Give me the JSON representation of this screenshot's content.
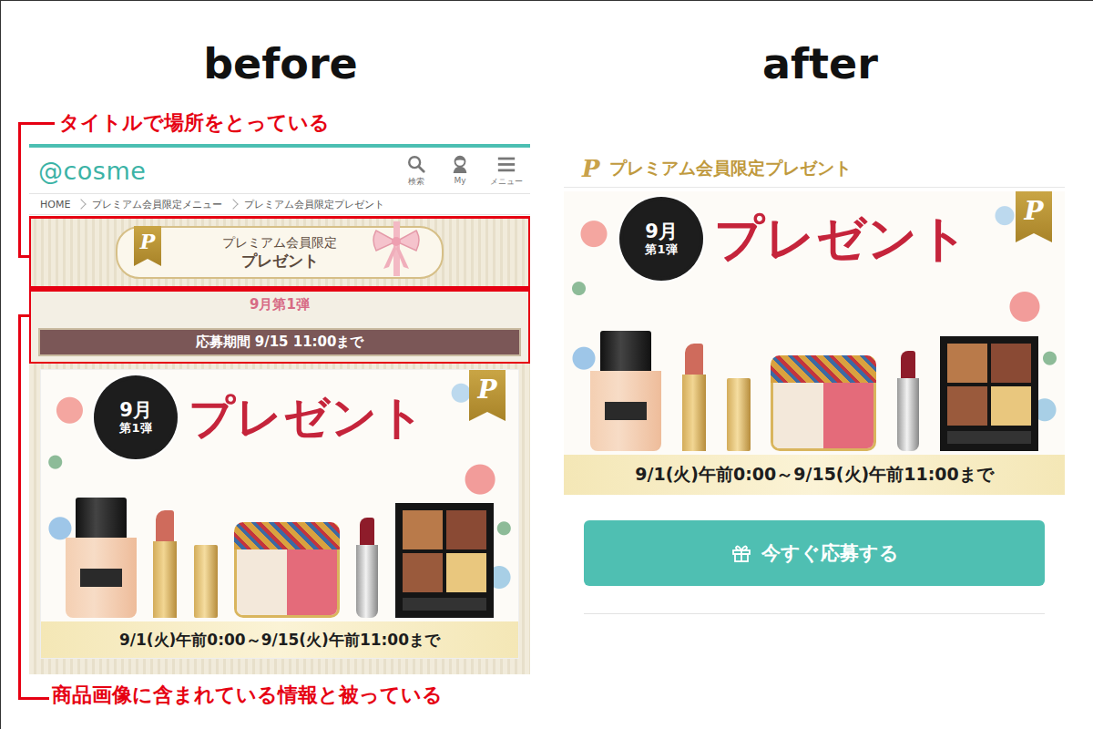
{
  "labels": {
    "before": "before",
    "after": "after"
  },
  "annotations": [
    {
      "text": "タイトルで場所をとっている"
    },
    {
      "text": "商品画像に含まれている情報と被っている"
    }
  ],
  "premium_mark": "P",
  "before": {
    "logo": "@cosme",
    "nav": [
      {
        "label": "検索"
      },
      {
        "label": "My"
      },
      {
        "label": "メニュー"
      }
    ],
    "breadcrumb": [
      "HOME",
      "プレミアム会員限定メニュー",
      "プレミアム会員限定プレゼント"
    ],
    "title_banner": {
      "line1": "プレミアム会員限定",
      "line2": "プレゼント"
    },
    "round": "9月第1弾",
    "period": "応募期間 9/15 11:00まで"
  },
  "banner": {
    "month": "9月",
    "round": "第1弾",
    "title": "プレゼント",
    "dates": "9/1(火)午前0:00～9/15(火)午前11:00まで"
  },
  "after": {
    "title": "プレミアム会員限定プレゼント",
    "button": "今すぐ応募する"
  }
}
